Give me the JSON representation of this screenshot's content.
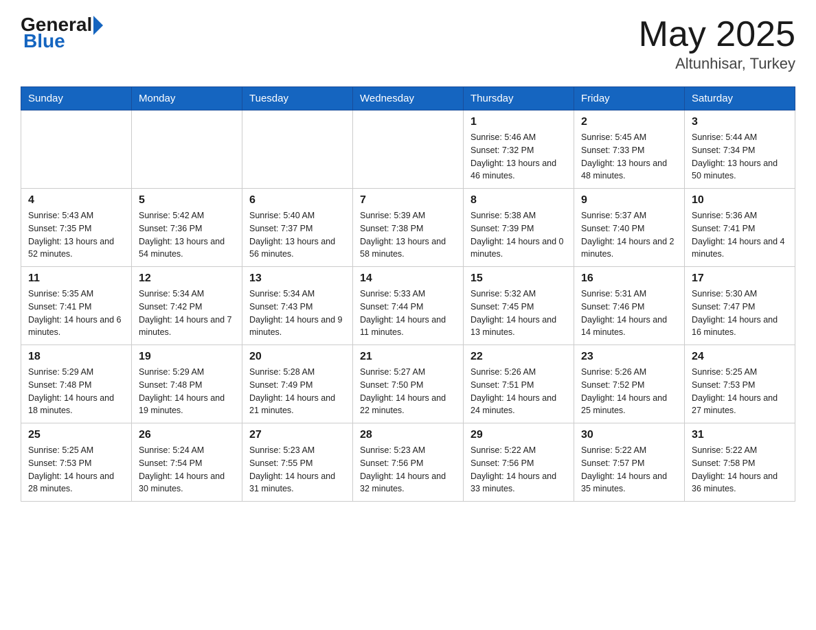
{
  "header": {
    "logo_general": "General",
    "logo_blue": "Blue",
    "month_title": "May 2025",
    "location": "Altunhisar, Turkey"
  },
  "days_of_week": [
    "Sunday",
    "Monday",
    "Tuesday",
    "Wednesday",
    "Thursday",
    "Friday",
    "Saturday"
  ],
  "weeks": [
    [
      {
        "day": "",
        "info": ""
      },
      {
        "day": "",
        "info": ""
      },
      {
        "day": "",
        "info": ""
      },
      {
        "day": "",
        "info": ""
      },
      {
        "day": "1",
        "info": "Sunrise: 5:46 AM\nSunset: 7:32 PM\nDaylight: 13 hours and 46 minutes."
      },
      {
        "day": "2",
        "info": "Sunrise: 5:45 AM\nSunset: 7:33 PM\nDaylight: 13 hours and 48 minutes."
      },
      {
        "day": "3",
        "info": "Sunrise: 5:44 AM\nSunset: 7:34 PM\nDaylight: 13 hours and 50 minutes."
      }
    ],
    [
      {
        "day": "4",
        "info": "Sunrise: 5:43 AM\nSunset: 7:35 PM\nDaylight: 13 hours and 52 minutes."
      },
      {
        "day": "5",
        "info": "Sunrise: 5:42 AM\nSunset: 7:36 PM\nDaylight: 13 hours and 54 minutes."
      },
      {
        "day": "6",
        "info": "Sunrise: 5:40 AM\nSunset: 7:37 PM\nDaylight: 13 hours and 56 minutes."
      },
      {
        "day": "7",
        "info": "Sunrise: 5:39 AM\nSunset: 7:38 PM\nDaylight: 13 hours and 58 minutes."
      },
      {
        "day": "8",
        "info": "Sunrise: 5:38 AM\nSunset: 7:39 PM\nDaylight: 14 hours and 0 minutes."
      },
      {
        "day": "9",
        "info": "Sunrise: 5:37 AM\nSunset: 7:40 PM\nDaylight: 14 hours and 2 minutes."
      },
      {
        "day": "10",
        "info": "Sunrise: 5:36 AM\nSunset: 7:41 PM\nDaylight: 14 hours and 4 minutes."
      }
    ],
    [
      {
        "day": "11",
        "info": "Sunrise: 5:35 AM\nSunset: 7:41 PM\nDaylight: 14 hours and 6 minutes."
      },
      {
        "day": "12",
        "info": "Sunrise: 5:34 AM\nSunset: 7:42 PM\nDaylight: 14 hours and 7 minutes."
      },
      {
        "day": "13",
        "info": "Sunrise: 5:34 AM\nSunset: 7:43 PM\nDaylight: 14 hours and 9 minutes."
      },
      {
        "day": "14",
        "info": "Sunrise: 5:33 AM\nSunset: 7:44 PM\nDaylight: 14 hours and 11 minutes."
      },
      {
        "day": "15",
        "info": "Sunrise: 5:32 AM\nSunset: 7:45 PM\nDaylight: 14 hours and 13 minutes."
      },
      {
        "day": "16",
        "info": "Sunrise: 5:31 AM\nSunset: 7:46 PM\nDaylight: 14 hours and 14 minutes."
      },
      {
        "day": "17",
        "info": "Sunrise: 5:30 AM\nSunset: 7:47 PM\nDaylight: 14 hours and 16 minutes."
      }
    ],
    [
      {
        "day": "18",
        "info": "Sunrise: 5:29 AM\nSunset: 7:48 PM\nDaylight: 14 hours and 18 minutes."
      },
      {
        "day": "19",
        "info": "Sunrise: 5:29 AM\nSunset: 7:48 PM\nDaylight: 14 hours and 19 minutes."
      },
      {
        "day": "20",
        "info": "Sunrise: 5:28 AM\nSunset: 7:49 PM\nDaylight: 14 hours and 21 minutes."
      },
      {
        "day": "21",
        "info": "Sunrise: 5:27 AM\nSunset: 7:50 PM\nDaylight: 14 hours and 22 minutes."
      },
      {
        "day": "22",
        "info": "Sunrise: 5:26 AM\nSunset: 7:51 PM\nDaylight: 14 hours and 24 minutes."
      },
      {
        "day": "23",
        "info": "Sunrise: 5:26 AM\nSunset: 7:52 PM\nDaylight: 14 hours and 25 minutes."
      },
      {
        "day": "24",
        "info": "Sunrise: 5:25 AM\nSunset: 7:53 PM\nDaylight: 14 hours and 27 minutes."
      }
    ],
    [
      {
        "day": "25",
        "info": "Sunrise: 5:25 AM\nSunset: 7:53 PM\nDaylight: 14 hours and 28 minutes."
      },
      {
        "day": "26",
        "info": "Sunrise: 5:24 AM\nSunset: 7:54 PM\nDaylight: 14 hours and 30 minutes."
      },
      {
        "day": "27",
        "info": "Sunrise: 5:23 AM\nSunset: 7:55 PM\nDaylight: 14 hours and 31 minutes."
      },
      {
        "day": "28",
        "info": "Sunrise: 5:23 AM\nSunset: 7:56 PM\nDaylight: 14 hours and 32 minutes."
      },
      {
        "day": "29",
        "info": "Sunrise: 5:22 AM\nSunset: 7:56 PM\nDaylight: 14 hours and 33 minutes."
      },
      {
        "day": "30",
        "info": "Sunrise: 5:22 AM\nSunset: 7:57 PM\nDaylight: 14 hours and 35 minutes."
      },
      {
        "day": "31",
        "info": "Sunrise: 5:22 AM\nSunset: 7:58 PM\nDaylight: 14 hours and 36 minutes."
      }
    ]
  ]
}
